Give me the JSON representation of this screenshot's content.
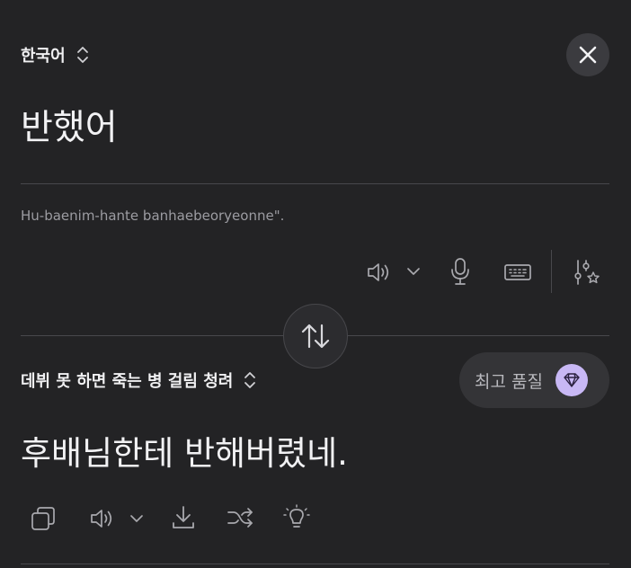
{
  "source": {
    "language": "한국어",
    "text": "반했어",
    "romanization": "Hu-baenim-hante banhaebeoryeonne\"."
  },
  "target": {
    "language": "데뷔 못 하면 죽는 병 걸림 청려",
    "text": "후배님한테 반해버렸네.",
    "quality_label": "최고 품질"
  },
  "colors": {
    "background": "#232325",
    "icon": "#a9a9ae",
    "quality_badge": "#c8b8f5"
  },
  "icons": {
    "close": "close-icon",
    "swap": "swap-vertical-icon",
    "speaker": "speaker-icon",
    "microphone": "microphone-icon",
    "keyboard": "keyboard-icon",
    "settings": "sliders-star-icon",
    "copy": "copy-icon",
    "download": "download-icon",
    "shuffle": "shuffle-icon",
    "idea": "lightbulb-icon",
    "quality": "diamond-icon"
  }
}
